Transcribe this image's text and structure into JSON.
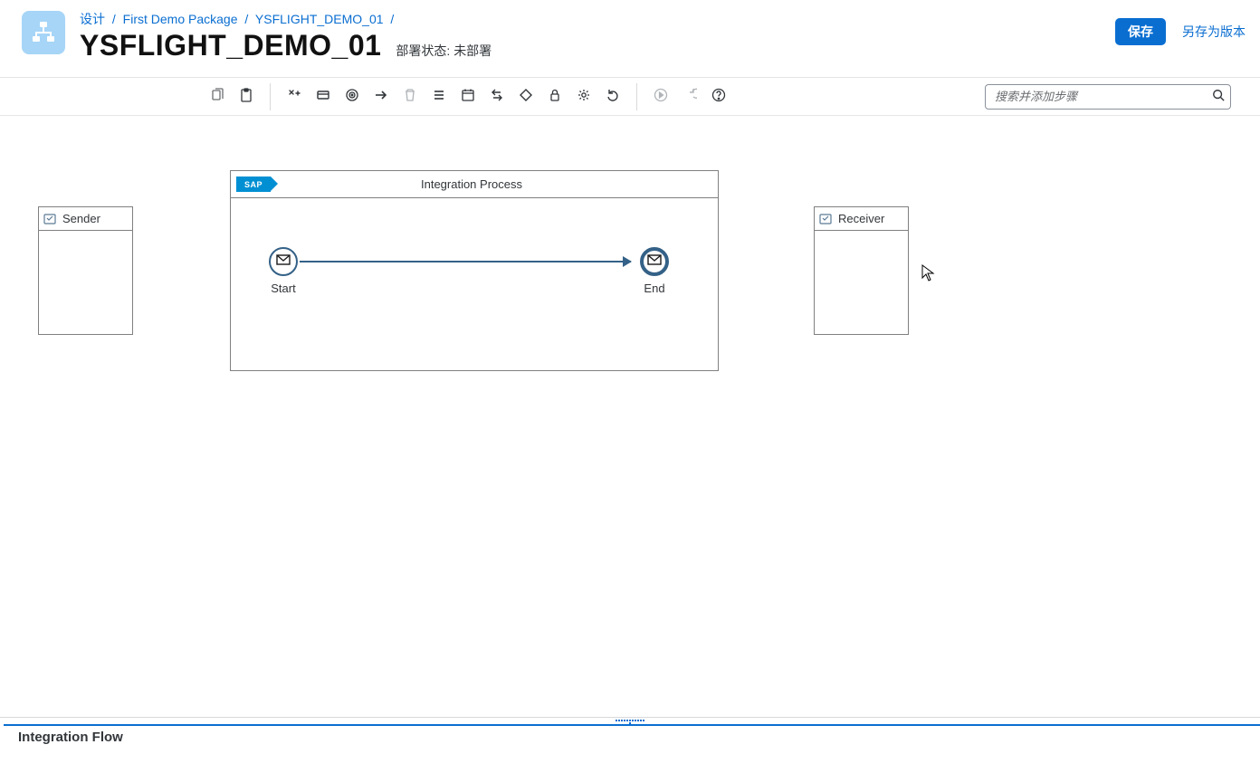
{
  "breadcrumb": {
    "design": "设计",
    "pkg": "First Demo Package",
    "iflow": "YSFLIGHT_DEMO_01"
  },
  "title": "YSFLIGHT_DEMO_01",
  "deploy": {
    "label": "部署状态:",
    "value": "未部署"
  },
  "actions": {
    "save": "保存",
    "save_as_version": "另存为版本"
  },
  "search": {
    "placeholder": "搜索并添加步骤"
  },
  "sap_badge": "SAP",
  "process": {
    "title": "Integration Process",
    "start_label": "Start",
    "end_label": "End"
  },
  "pools": {
    "sender": "Sender",
    "receiver": "Receiver"
  },
  "bottom": {
    "title": "Integration Flow"
  }
}
